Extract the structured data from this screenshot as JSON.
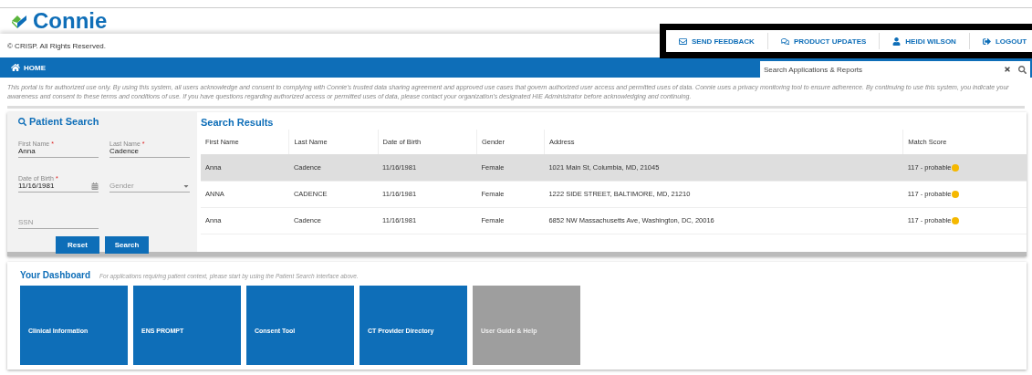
{
  "logo": {
    "text": "Connie"
  },
  "copyright": "© CRISP. All Rights Reserved.",
  "top_links": [
    {
      "kind": "mail",
      "label": "SEND FEEDBACK"
    },
    {
      "kind": "chat",
      "label": "PRODUCT UPDATES"
    },
    {
      "kind": "user",
      "label": "HEIDI WILSON"
    },
    {
      "kind": "logout",
      "label": "LOGOUT"
    }
  ],
  "nav": {
    "home": "HOME",
    "search_placeholder": "Search Applications & Reports"
  },
  "disclaimer": "This portal is for authorized use only. By using this system, all users acknowledge and consent to complying with Connie's trusted data sharing agreement and approved use cases that govern authorized user access and permitted uses of data. Connie uses a privacy monitoring tool to ensure adherence. By continuing to use this system, you indicate your awareness and consent to these terms and conditions of use. If you have questions regarding authorized access or permitted uses of data, please contact your organization's designated HIE Administrator before acknowledging and continuing.",
  "patient_search": {
    "title": "Patient Search",
    "fields": [
      {
        "kind": "text",
        "label": "First Name",
        "required_mark": "*",
        "value": "Anna"
      },
      {
        "kind": "text",
        "label": "Last Name",
        "required_mark": "*",
        "value": "Cadence"
      },
      {
        "kind": "date",
        "label": "Date of Birth",
        "required_mark": "*",
        "value": "11/16/1981"
      },
      {
        "kind": "select",
        "placeholder": "Gender"
      },
      {
        "kind": "text",
        "placeholder": "SSN"
      }
    ],
    "buttons": [
      "Reset",
      "Search"
    ]
  },
  "search_results": {
    "title": "Search Results",
    "columns": [
      "First Name",
      "Last Name",
      "Date of Birth",
      "Gender",
      "Address",
      "Match Score"
    ],
    "rows": [
      {
        "selected": true,
        "cells": [
          "Anna",
          "Cadence",
          "11/16/1981",
          "Female",
          "1021 Main St, Columbia, MD, 21045",
          "117 - probable"
        ],
        "color": "#f5b800"
      },
      {
        "selected": false,
        "cells": [
          "ANNA",
          "CADENCE",
          "11/16/1981",
          "Female",
          "1222 SIDE STREET, BALTIMORE, MD, 21210",
          "117 - probable"
        ],
        "color": "#f5b800"
      },
      {
        "selected": false,
        "cells": [
          "Anna",
          "Cadence",
          "11/16/1981",
          "Female",
          "6852 NW Massachusetts Ave, Washington, DC, 20016",
          "117 - probable"
        ],
        "color": "#f5b800"
      }
    ]
  },
  "dashboard": {
    "title": "Your Dashboard",
    "hint": "For applications requiring patient context, please start by using the Patient Search interface above.",
    "tiles": [
      {
        "label": "Clinical Information",
        "disabled": false
      },
      {
        "label": "ENS PROMPT",
        "disabled": false
      },
      {
        "label": "Consent Tool",
        "disabled": false
      },
      {
        "label": "CT Provider Directory",
        "disabled": false
      },
      {
        "label": "User Guide & Help",
        "disabled": true
      }
    ]
  }
}
